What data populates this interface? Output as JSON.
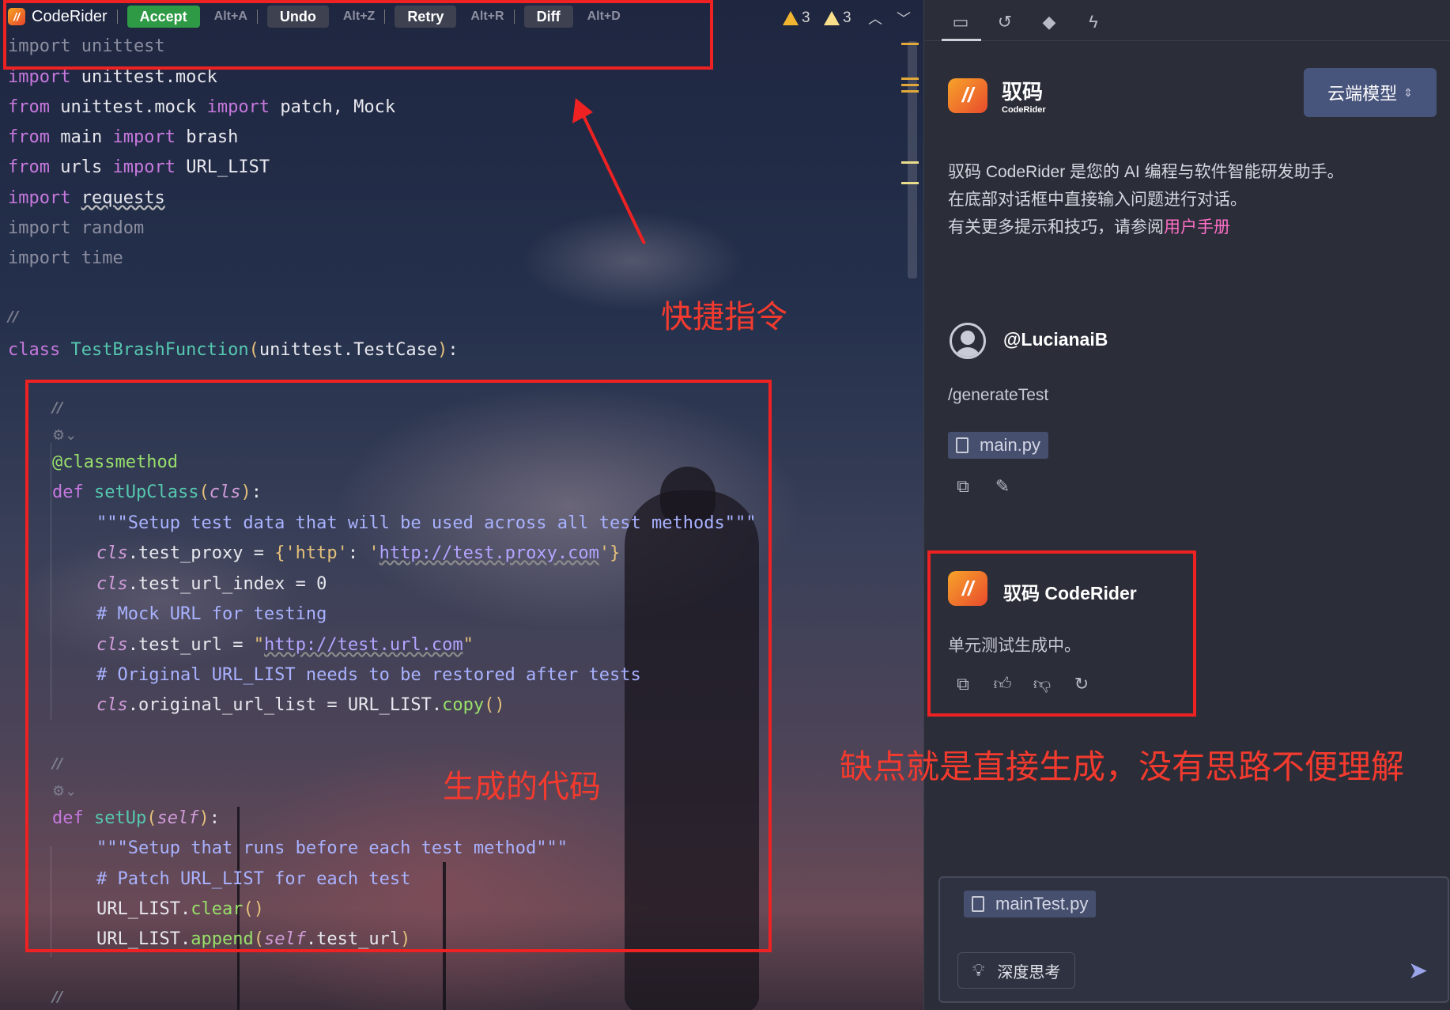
{
  "toolbar": {
    "app_name": "CodeRider",
    "accept_label": "Accept",
    "accept_shortcut": "Alt+A",
    "undo_label": "Undo",
    "undo_shortcut": "Alt+Z",
    "retry_label": "Retry",
    "retry_shortcut": "Alt+R",
    "diff_label": "Diff",
    "diff_shortcut": "Alt+D",
    "warnings_count": "3",
    "weak_warnings_count": "3"
  },
  "code_lines": {
    "l1": "import unittest",
    "l2a": "import",
    "l2b": " unittest.mock",
    "l3a": "from",
    "l3b": " unittest.mock ",
    "l3c": "import",
    "l3d": " patch, Mock",
    "l4a": "from",
    "l4b": " main ",
    "l4c": "import",
    "l4d": " brash",
    "l5a": "from",
    "l5b": " urls ",
    "l5c": "import",
    "l5d": " URL_LIST",
    "l6a": "import",
    "l6b": "requests",
    "l7": "import random",
    "l8": "import time",
    "class_kw": "class",
    "class_name": "TestBrashFunction",
    "class_base": "unittest.TestCase",
    "decorator": "@classmethod",
    "def_kw": "def",
    "setupclass_name": "setUpClass",
    "cls_param": "cls",
    "docstring1": "\"\"\"Setup test data that will be used across all test methods\"\"\"",
    "proxy_lhs": ".test_proxy = ",
    "proxy_key": "'http'",
    "proxy_url": "http://test.proxy.com",
    "url_index": ".test_url_index = 0",
    "comment1": "# Mock URL for testing",
    "test_url_lhs": ".test_url = ",
    "test_url_value": "http://test.url.com",
    "comment2": "# Original URL_LIST needs to be restored after tests",
    "orig_list_lhs": ".original_url_list = URL_LIST.",
    "copy_fn": "copy",
    "setup_name": "setUp",
    "self_param": "self",
    "docstring2": "\"\"\"Setup that runs before each test method\"\"\"",
    "comment3": "# Patch URL_LIST for each test",
    "clear_lhs": "URL_LIST.",
    "clear_fn": "clear",
    "append_lhs": "URL_LIST.",
    "append_fn": "append",
    "append_arg": ".test_url"
  },
  "annotations": {
    "shortcut_note": "快捷指令",
    "generated_note": "生成的代码",
    "drawback_note": "缺点就是直接生成，没有思路不便理解"
  },
  "panel": {
    "brand_cn": "驭码",
    "brand_en": "CodeRider",
    "model_select": "云端模型",
    "intro_line1": "驭码 CodeRider 是您的 AI 编程与软件智能研发助手。",
    "intro_line2": "在底部对话框中直接输入问题进行对话。",
    "intro_line3_prefix": "有关更多提示和技巧，请参阅",
    "intro_link": "用户手册",
    "user_name": "@LucianaiB",
    "user_message": "/generateTest",
    "attached_file": "main.py",
    "bot_name": "驭码 CodeRider",
    "bot_message": "单元测试生成中。",
    "input_file": "mainTest.py",
    "deep_think_label": "深度思考"
  },
  "colors": {
    "accept_green": "#2f9a46",
    "annotation_red": "#ee2222",
    "link_pink": "#ff6ec7"
  }
}
